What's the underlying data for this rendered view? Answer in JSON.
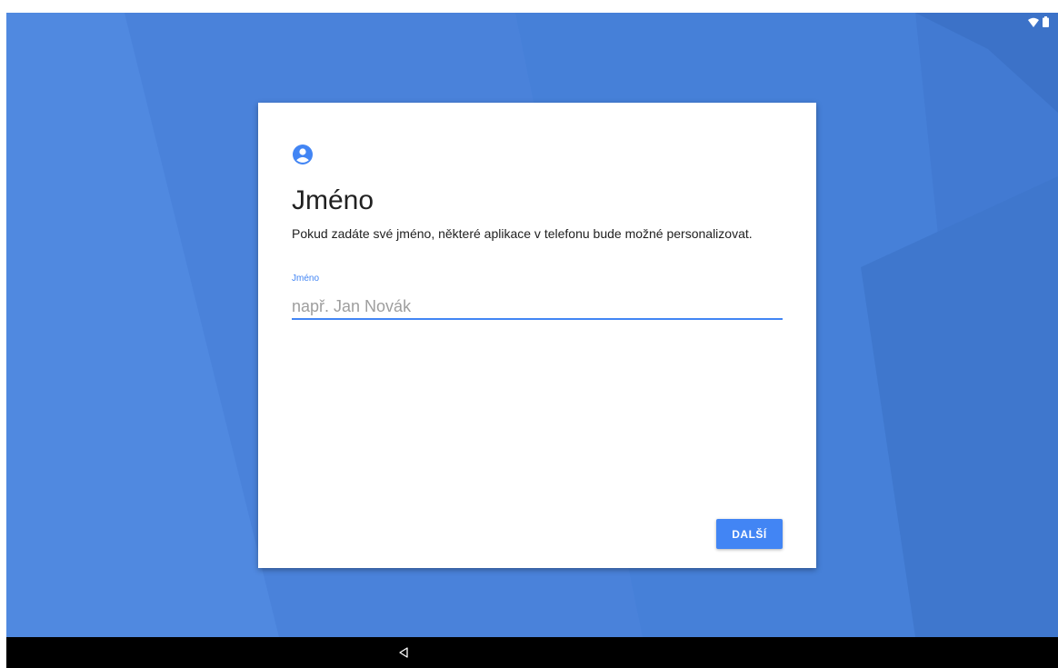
{
  "status_bar": {
    "icons": [
      "wifi-icon",
      "battery-icon"
    ]
  },
  "card": {
    "icon": "account-circle-icon",
    "title": "Jméno",
    "description": "Pokud zadáte své jméno, některé aplikace v telefonu bude možné personalizovat.",
    "name_field": {
      "label": "Jméno",
      "placeholder": "např. Jan Novák",
      "value": ""
    },
    "next_label": "DALŠÍ"
  },
  "nav_bar": {
    "icons": [
      "back-icon"
    ]
  },
  "colors": {
    "accent": "#4285f4",
    "wallpaper": "#4a84dc",
    "nav_bar": "#000000"
  }
}
